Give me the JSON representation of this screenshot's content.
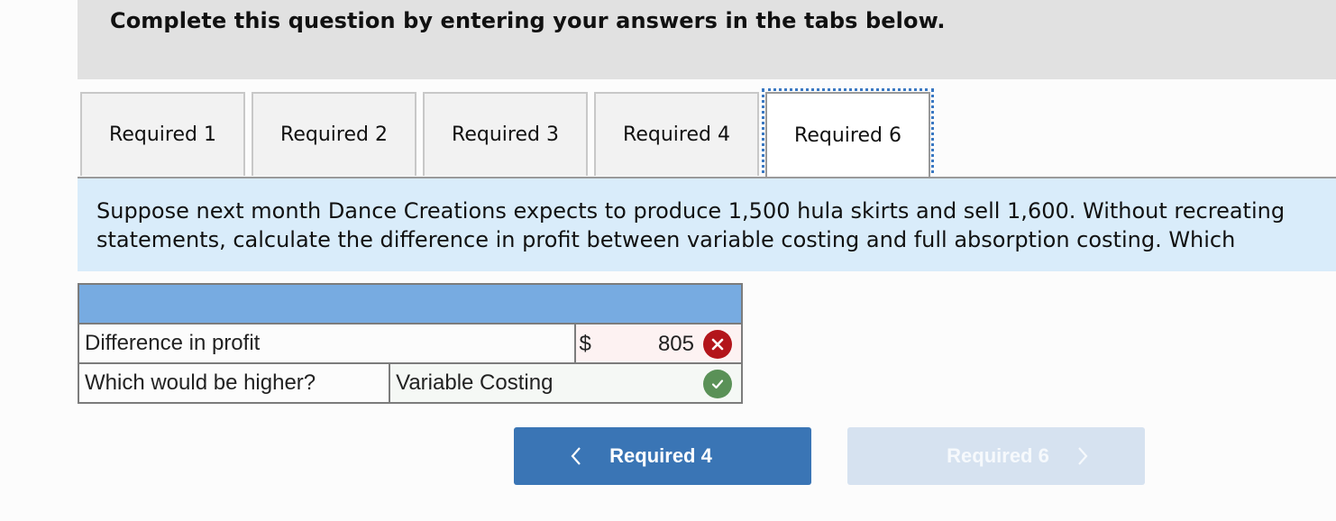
{
  "header": {
    "instruction": "Complete this question by entering your answers in the tabs below."
  },
  "tabs": [
    {
      "label": "Required 1",
      "active": false
    },
    {
      "label": "Required 2",
      "active": false
    },
    {
      "label": "Required 3",
      "active": false
    },
    {
      "label": "Required 4",
      "active": false
    },
    {
      "label": "Required 6",
      "active": true
    }
  ],
  "prompt": {
    "text": "Suppose next month Dance Creations expects to produce 1,500 hula skirts and sell 1,600. Without recreating\nstatements, calculate the difference in profit between variable costing and full absorption costing. Which"
  },
  "answer_table": {
    "rows": [
      {
        "label": "Difference in profit",
        "currency": "$",
        "value": "805",
        "status": "incorrect",
        "status_icon": "x-circle-icon"
      },
      {
        "label": "Which would be higher?",
        "value": "Variable Costing",
        "status": "correct",
        "status_icon": "check-circle-icon"
      }
    ]
  },
  "navigation": {
    "prev_label": "Required 4",
    "next_label": "Required 6",
    "next_disabled": true
  },
  "colors": {
    "tab_focus_outline": "#3a78c2",
    "table_header": "#77abe1",
    "prompt_bg": "#d9ecfa",
    "incorrect": "#b3151b",
    "correct": "#5a9157",
    "prev_button": "#3a75b5",
    "next_button_disabled": "#d6e2f0"
  }
}
